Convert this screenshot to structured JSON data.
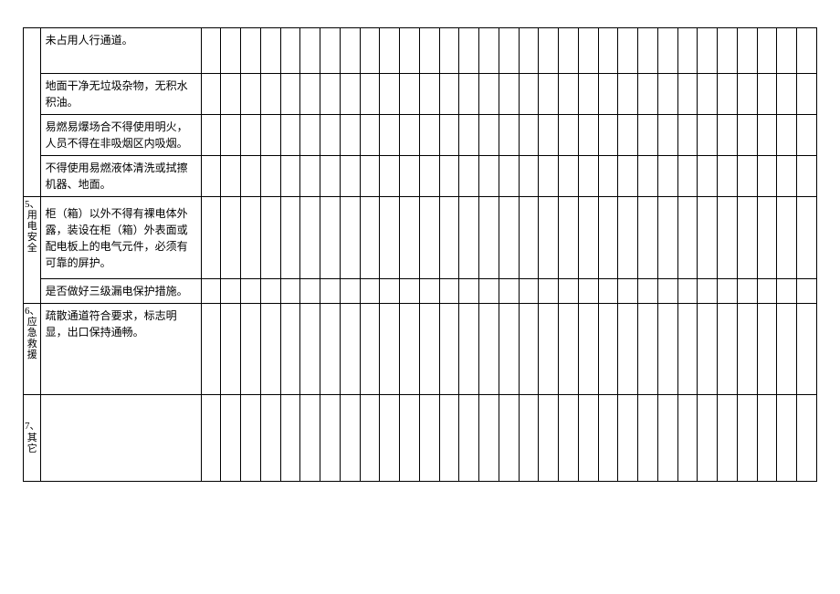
{
  "categories": {
    "cat5": "5、用电安全",
    "cat6": "6、应急救援",
    "cat7": "7、其它"
  },
  "rows": [
    {
      "cat": null,
      "desc": "未占用人行通道。"
    },
    {
      "cat": null,
      "desc": "地面干净无垃圾杂物，无积水积油。"
    },
    {
      "cat": null,
      "desc": "易燃易爆场合不得使用明火，人员不得在非吸烟区内吸烟。"
    },
    {
      "cat": null,
      "desc": "不得使用易燃液体清洗或拭擦机器、地面。"
    },
    {
      "cat": "cat5",
      "desc": "柜（箱）以外不得有裸电体外露，装设在柜（箱）外表面或配电板上的电气元件，必须有可靠的屏护。"
    },
    {
      "cat": null,
      "desc": "是否做好三级漏电保护措施。"
    },
    {
      "cat": "cat6",
      "desc": "疏散通道符合要求，标志明显，出口保持通畅。"
    },
    {
      "cat": "cat7",
      "desc": ""
    }
  ]
}
